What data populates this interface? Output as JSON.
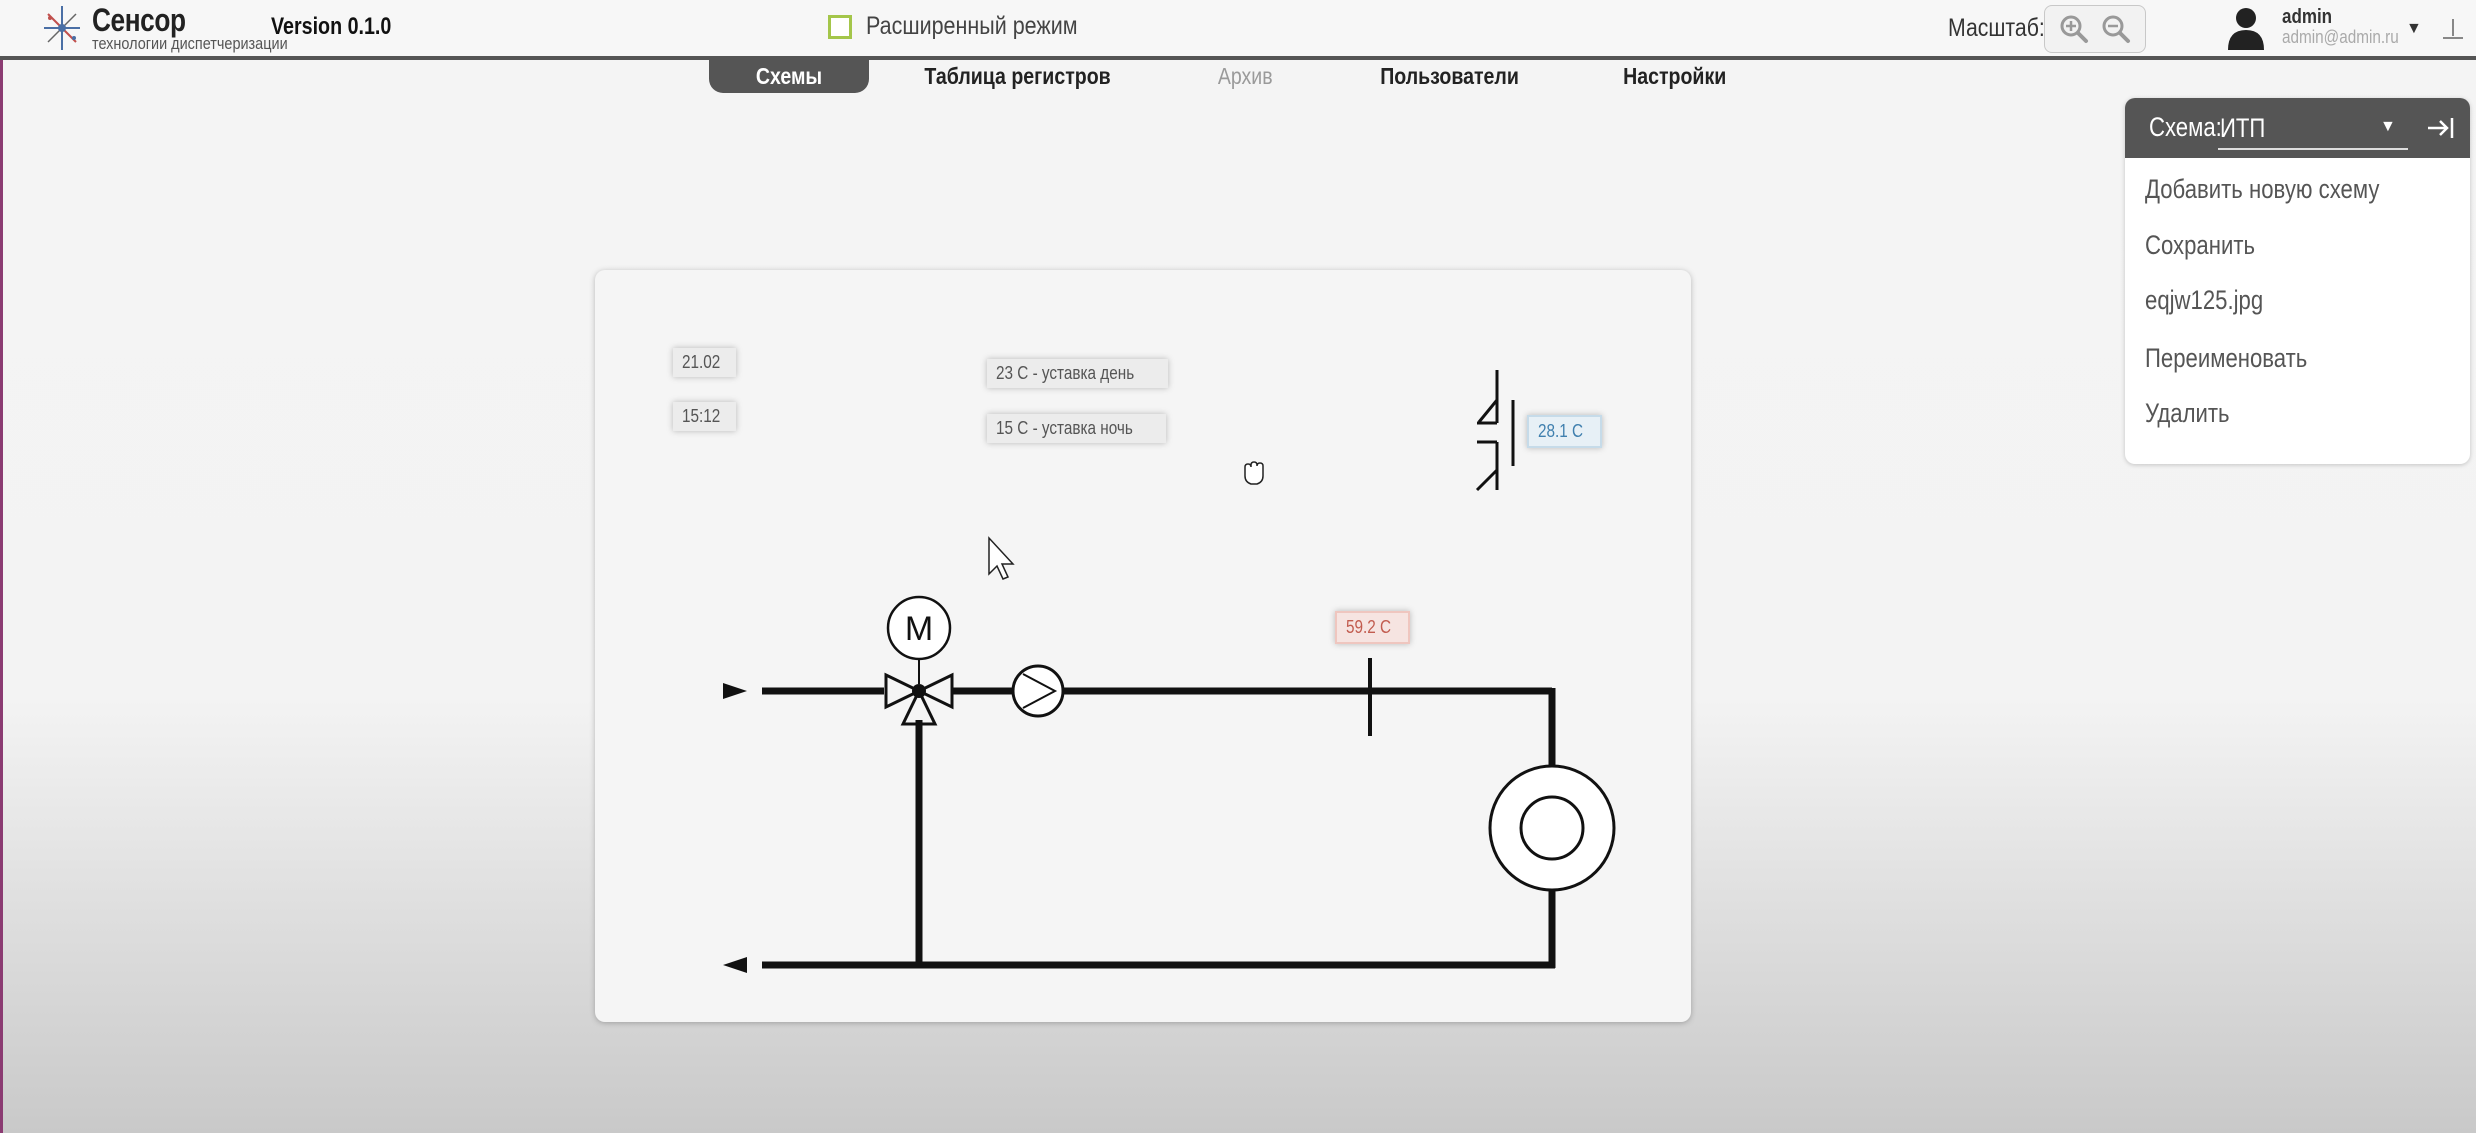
{
  "app": {
    "brand": "Сенсор",
    "brand_subtitle": "технологии диспетчеризации",
    "version": "Version 0.1.0"
  },
  "header": {
    "advanced_mode_label": "Расширенный режим",
    "advanced_mode_checked": false,
    "scale_label": "Масштаб:",
    "zoom_in_icon": "zoom-in-icon",
    "zoom_out_icon": "zoom-out-icon",
    "user": {
      "name": "admin",
      "email": "admin@admin.ru"
    }
  },
  "tabs": [
    {
      "label": "Схемы",
      "active": true
    },
    {
      "label": "Таблица регистров",
      "active": false
    },
    {
      "label": "Архив",
      "active": false,
      "disabled": true
    },
    {
      "label": "Пользователи",
      "active": false
    },
    {
      "label": "Настройки",
      "active": false
    }
  ],
  "scheme": {
    "date": "21.02",
    "time": "15:12",
    "setpoint_day": "23 С - уставка день",
    "setpoint_night": "15 С - уставка ночь",
    "outdoor_temp": "28.1 С",
    "supply_temp": "59.2 С",
    "motor_label": "M"
  },
  "panel": {
    "title": "Схема:",
    "selected": "ИТП",
    "items": [
      "Добавить новую схему",
      "Сохранить",
      "eqjw125.jpg",
      "Переименовать",
      "Удалить"
    ]
  },
  "colors": {
    "accent_dark": "#555555",
    "checkbox_border": "#a4c64a",
    "temp_blue": "#3f7fae",
    "temp_red": "#c25c4f"
  }
}
